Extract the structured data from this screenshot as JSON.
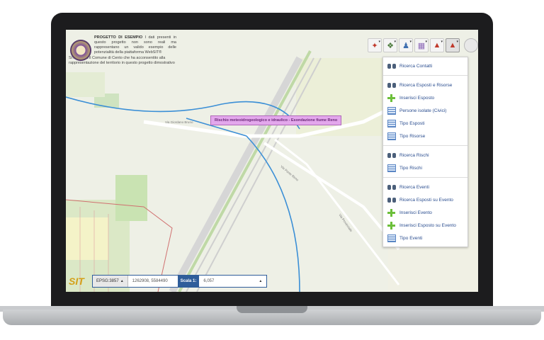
{
  "info": {
    "heading": "PROGETTO DI ESEMPIO",
    "text1": " I dati presenti in questo progetto non sono reali ma rappresentano un valido esempio delle potenzialità della piattaforma WebSIT®",
    "text2": "Si ringrazia il Comune di Cento che ha acconsentito alla rappresentazione del territorio in questo progetto dimostrativo"
  },
  "tooltip": "Rischio meteoidrogeologico e idraulico - Esondazione fiume Reno",
  "menu": {
    "ricerca_contatti": "Ricerca Contatti",
    "ricerca_esposti": "Ricerca Esposti e Risorse",
    "inserisci_esposto": "Inserisci Esposto",
    "persone_isolate": "Persone isolate (Civici)",
    "tipo_esposti": "Tipo Esposti",
    "tipo_risorse": "Tipo Risorse",
    "ricerca_rischi": "Ricerca Rischi",
    "tipo_rischi": "Tipo Rischi",
    "ricerca_eventi": "Ricerca Eventi",
    "ricerca_esposti_evento": "Ricerca Esposti su Evento",
    "inserisci_evento": "Inserisci Evento",
    "inserisci_esposto_evento": "Inserisci Esposto su Evento",
    "tipo_eventi": "Tipo Eventi"
  },
  "toolbar": {
    "icons": [
      "network-icon",
      "map-layers-icon",
      "people-icon",
      "grid-map-icon",
      "triangle-tools-icon",
      "hazard-tools-icon"
    ]
  },
  "bottom": {
    "brand": "SIT",
    "epsg": "EPSG:3857",
    "coords": "1262908, 5584490",
    "scale_label": "Scala 1:",
    "scale_value": "6,057"
  },
  "roads": {
    "r1": "Via Giordano Bruno",
    "r2": "Via Ponte Reno",
    "r3": "Via Provinciale"
  },
  "colors": {
    "accent": "#2f5d9a",
    "tooltip_bg": "#e3a7ec",
    "link": "#2a4d8f"
  }
}
